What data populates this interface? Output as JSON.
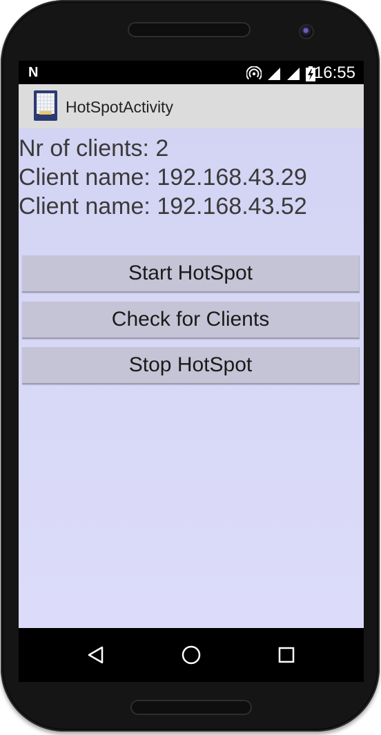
{
  "status_bar": {
    "notification_icon": "n-icon",
    "n_glyph": "N",
    "icons": [
      "hotspot-icon",
      "signal-icon",
      "signal-icon",
      "battery-charging-icon"
    ],
    "time": "16:55"
  },
  "app_bar": {
    "title": "HotSpotActivity",
    "icon": "app-icon"
  },
  "info": {
    "clients_count": "Nr of clients: 2",
    "clients": [
      "Client name: 192.168.43.29",
      "Client name: 192.168.43.52"
    ]
  },
  "buttons": {
    "start": "Start HotSpot",
    "check": "Check for Clients",
    "stop": "Stop HotSpot"
  },
  "nav_bar": {
    "icons": [
      "back-icon",
      "home-icon",
      "recents-icon"
    ]
  },
  "colors": {
    "content_bg": "#d8d8f6",
    "button_bg": "#c4c4d6",
    "app_bar_bg": "#dcdcdc",
    "phone_body": "#151515"
  }
}
